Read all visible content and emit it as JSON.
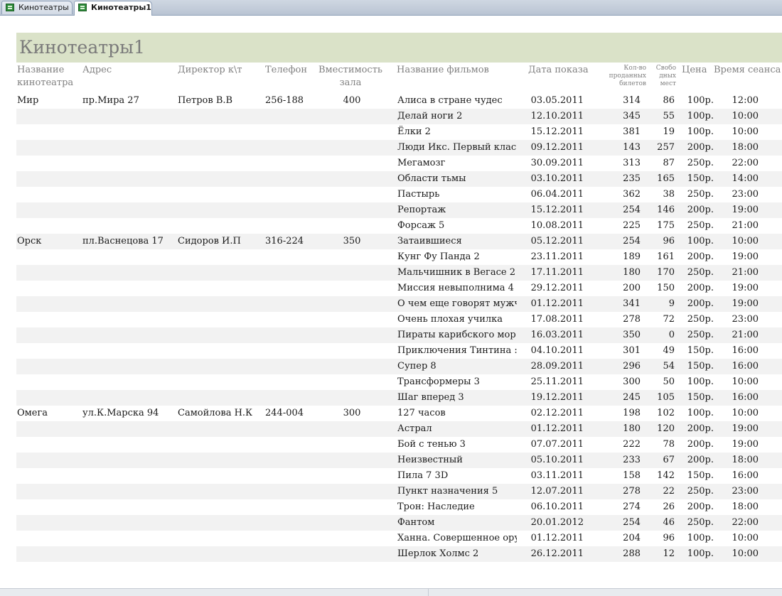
{
  "tabs": [
    {
      "label": "Кинотеатры",
      "active": false
    },
    {
      "label": "Кинотеатры1",
      "active": true
    }
  ],
  "report": {
    "title": "Кинотеатры1",
    "headers": {
      "name": "Название кинотеатра",
      "address": "Адрес",
      "director": "Директор к\\т",
      "phone": "Телефон",
      "capacity": "Вместимость зала",
      "film": "Название фильмов",
      "date": "Дата показа",
      "sold": "Кол-во проданных билетов",
      "free": "Свобо дных мест",
      "price": "Цена",
      "time": "Время сеанса"
    },
    "rows": [
      {
        "name": "Мир",
        "address": "пр.Мира 27",
        "director": "Петров В.В",
        "phone": "256-188",
        "capacity": "400",
        "film": "Алиса в стране чудес",
        "date": "03.05.2011",
        "sold": "314",
        "free": "86",
        "price": "100р.",
        "time": "12:00"
      },
      {
        "name": "",
        "address": "",
        "director": "",
        "phone": "",
        "capacity": "",
        "film": "Делай ноги 2",
        "date": "12.10.2011",
        "sold": "345",
        "free": "55",
        "price": "100р.",
        "time": "10:00"
      },
      {
        "name": "",
        "address": "",
        "director": "",
        "phone": "",
        "capacity": "",
        "film": "Ёлки 2",
        "date": "15.12.2011",
        "sold": "381",
        "free": "19",
        "price": "100р.",
        "time": "10:00"
      },
      {
        "name": "",
        "address": "",
        "director": "",
        "phone": "",
        "capacity": "",
        "film": "Люди Икс. Первый клас",
        "date": "09.12.2011",
        "sold": "143",
        "free": "257",
        "price": "200р.",
        "time": "18:00"
      },
      {
        "name": "",
        "address": "",
        "director": "",
        "phone": "",
        "capacity": "",
        "film": "Мегамозг",
        "date": "30.09.2011",
        "sold": "313",
        "free": "87",
        "price": "250р.",
        "time": "22:00"
      },
      {
        "name": "",
        "address": "",
        "director": "",
        "phone": "",
        "capacity": "",
        "film": "Области тьмы",
        "date": "03.10.2011",
        "sold": "235",
        "free": "165",
        "price": "150р.",
        "time": "14:00"
      },
      {
        "name": "",
        "address": "",
        "director": "",
        "phone": "",
        "capacity": "",
        "film": "Пастырь",
        "date": "06.04.2011",
        "sold": "362",
        "free": "38",
        "price": "250р.",
        "time": "23:00"
      },
      {
        "name": "",
        "address": "",
        "director": "",
        "phone": "",
        "capacity": "",
        "film": "Репортаж",
        "date": "15.12.2011",
        "sold": "254",
        "free": "146",
        "price": "200р.",
        "time": "19:00"
      },
      {
        "name": "",
        "address": "",
        "director": "",
        "phone": "",
        "capacity": "",
        "film": "Форсаж 5",
        "date": "10.08.2011",
        "sold": "225",
        "free": "175",
        "price": "250р.",
        "time": "21:00"
      },
      {
        "name": "Орск",
        "address": "пл.Васнецова 17",
        "director": "Сидоров И.П",
        "phone": "316-224",
        "capacity": "350",
        "film": "Затаившиеся",
        "date": "05.12.2011",
        "sold": "254",
        "free": "96",
        "price": "100р.",
        "time": "10:00"
      },
      {
        "name": "",
        "address": "",
        "director": "",
        "phone": "",
        "capacity": "",
        "film": "Кунг Фу Панда 2",
        "date": "23.11.2011",
        "sold": "189",
        "free": "161",
        "price": "200р.",
        "time": "19:00"
      },
      {
        "name": "",
        "address": "",
        "director": "",
        "phone": "",
        "capacity": "",
        "film": "Мальчишник в Вегасе 2",
        "date": "17.11.2011",
        "sold": "180",
        "free": "170",
        "price": "250р.",
        "time": "21:00"
      },
      {
        "name": "",
        "address": "",
        "director": "",
        "phone": "",
        "capacity": "",
        "film": "Миссия невыполнима 4",
        "date": "29.12.2011",
        "sold": "200",
        "free": "150",
        "price": "200р.",
        "time": "19:00"
      },
      {
        "name": "",
        "address": "",
        "director": "",
        "phone": "",
        "capacity": "",
        "film": "О чем еще говорят мужч",
        "date": "01.12.2011",
        "sold": "341",
        "free": "9",
        "price": "200р.",
        "time": "19:00"
      },
      {
        "name": "",
        "address": "",
        "director": "",
        "phone": "",
        "capacity": "",
        "film": "Очень плохая училка",
        "date": "17.08.2011",
        "sold": "278",
        "free": "72",
        "price": "250р.",
        "time": "23:00"
      },
      {
        "name": "",
        "address": "",
        "director": "",
        "phone": "",
        "capacity": "",
        "film": "Пираты карибского мор:",
        "date": "16.03.2011",
        "sold": "350",
        "free": "0",
        "price": "250р.",
        "time": "21:00"
      },
      {
        "name": "",
        "address": "",
        "director": "",
        "phone": "",
        "capacity": "",
        "film": "Приключения Тинтина :",
        "date": "04.10.2011",
        "sold": "301",
        "free": "49",
        "price": "150р.",
        "time": "16:00"
      },
      {
        "name": "",
        "address": "",
        "director": "",
        "phone": "",
        "capacity": "",
        "film": "Супер 8",
        "date": "28.09.2011",
        "sold": "296",
        "free": "54",
        "price": "150р.",
        "time": "16:00"
      },
      {
        "name": "",
        "address": "",
        "director": "",
        "phone": "",
        "capacity": "",
        "film": "Трансформеры 3",
        "date": "25.11.2011",
        "sold": "300",
        "free": "50",
        "price": "100р.",
        "time": "10:00"
      },
      {
        "name": "",
        "address": "",
        "director": "",
        "phone": "",
        "capacity": "",
        "film": "Шаг вперед 3",
        "date": "19.12.2011",
        "sold": "245",
        "free": "105",
        "price": "150р.",
        "time": "16:00"
      },
      {
        "name": "Омега",
        "address": "ул.К.Марска 94",
        "director": "Самойлова Н.К",
        "phone": "244-004",
        "capacity": "300",
        "film": "127 часов",
        "date": "02.12.2011",
        "sold": "198",
        "free": "102",
        "price": "100р.",
        "time": "10:00"
      },
      {
        "name": "",
        "address": "",
        "director": "",
        "phone": "",
        "capacity": "",
        "film": "Астрал",
        "date": "01.12.2011",
        "sold": "180",
        "free": "120",
        "price": "200р.",
        "time": "19:00"
      },
      {
        "name": "",
        "address": "",
        "director": "",
        "phone": "",
        "capacity": "",
        "film": "Бой с тенью 3",
        "date": "07.07.2011",
        "sold": "222",
        "free": "78",
        "price": "200р.",
        "time": "19:00"
      },
      {
        "name": "",
        "address": "",
        "director": "",
        "phone": "",
        "capacity": "",
        "film": "Неизвестный",
        "date": "05.10.2011",
        "sold": "233",
        "free": "67",
        "price": "200р.",
        "time": "18:00"
      },
      {
        "name": "",
        "address": "",
        "director": "",
        "phone": "",
        "capacity": "",
        "film": "Пила 7 3D",
        "date": "03.11.2011",
        "sold": "158",
        "free": "142",
        "price": "150р.",
        "time": "16:00"
      },
      {
        "name": "",
        "address": "",
        "director": "",
        "phone": "",
        "capacity": "",
        "film": "Пункт назначения 5",
        "date": "12.07.2011",
        "sold": "278",
        "free": "22",
        "price": "250р.",
        "time": "23:00"
      },
      {
        "name": "",
        "address": "",
        "director": "",
        "phone": "",
        "capacity": "",
        "film": "Трон: Наследие",
        "date": "06.10.2011",
        "sold": "274",
        "free": "26",
        "price": "200р.",
        "time": "18:00"
      },
      {
        "name": "",
        "address": "",
        "director": "",
        "phone": "",
        "capacity": "",
        "film": "Фантом",
        "date": "20.01.2012",
        "sold": "254",
        "free": "46",
        "price": "250р.",
        "time": "22:00"
      },
      {
        "name": "",
        "address": "",
        "director": "",
        "phone": "",
        "capacity": "",
        "film": "Ханна. Совершенное ору",
        "date": "01.12.2011",
        "sold": "204",
        "free": "96",
        "price": "100р.",
        "time": "10:00"
      },
      {
        "name": "",
        "address": "",
        "director": "",
        "phone": "",
        "capacity": "",
        "film": "Шерлок Холмс 2",
        "date": "26.12.2011",
        "sold": "288",
        "free": "12",
        "price": "100р.",
        "time": "10:00"
      }
    ]
  },
  "colors": {
    "title_band": "#dae2c8",
    "alt_row": "#f2f2f2",
    "header_text": "#808080"
  }
}
